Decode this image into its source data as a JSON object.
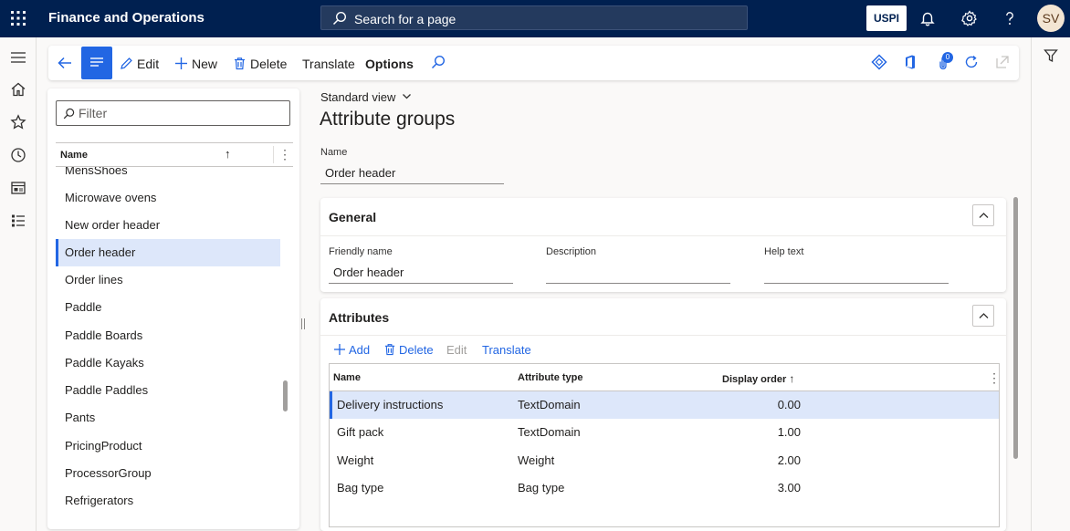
{
  "app": {
    "title": "Finance and Operations",
    "search_placeholder": "Search for a page",
    "company": "USPI",
    "user_initials": "SV"
  },
  "actionpane": {
    "edit": "Edit",
    "new": "New",
    "delete": "Delete",
    "translate": "Translate",
    "options": "Options",
    "badge_count": "0"
  },
  "listpane": {
    "filter_placeholder": "Filter",
    "column": "Name",
    "items": [
      "MensShoes",
      "Microwave ovens",
      "New order header",
      "Order header",
      "Order lines",
      "Paddle",
      "Paddle Boards",
      "Paddle Kayaks",
      "Paddle Paddles",
      "Pants",
      "PricingProduct",
      "ProcessorGroup",
      "Refrigerators"
    ],
    "selected": "Order header"
  },
  "details": {
    "view": "Standard view",
    "title": "Attribute groups",
    "name_label": "Name",
    "name_value": "Order header",
    "general": {
      "title": "General",
      "friendly_name_label": "Friendly name",
      "friendly_name_value": "Order header",
      "description_label": "Description",
      "description_value": "",
      "help_text_label": "Help text",
      "help_text_value": ""
    },
    "attributes": {
      "title": "Attributes",
      "add": "Add",
      "delete": "Delete",
      "edit": "Edit",
      "translate": "Translate",
      "columns": {
        "name": "Name",
        "attribute_type": "Attribute type",
        "display_order": "Display order"
      },
      "rows": [
        {
          "name": "Delivery instructions",
          "type": "TextDomain",
          "order": "0.00"
        },
        {
          "name": "Gift pack",
          "type": "TextDomain",
          "order": "1.00"
        },
        {
          "name": "Weight",
          "type": "Weight",
          "order": "2.00"
        },
        {
          "name": "Bag type",
          "type": "Bag type",
          "order": "3.00"
        }
      ]
    }
  },
  "colors": {
    "nav": "#002050",
    "accent": "#2266e3",
    "selected_row": "#dde7fa"
  }
}
